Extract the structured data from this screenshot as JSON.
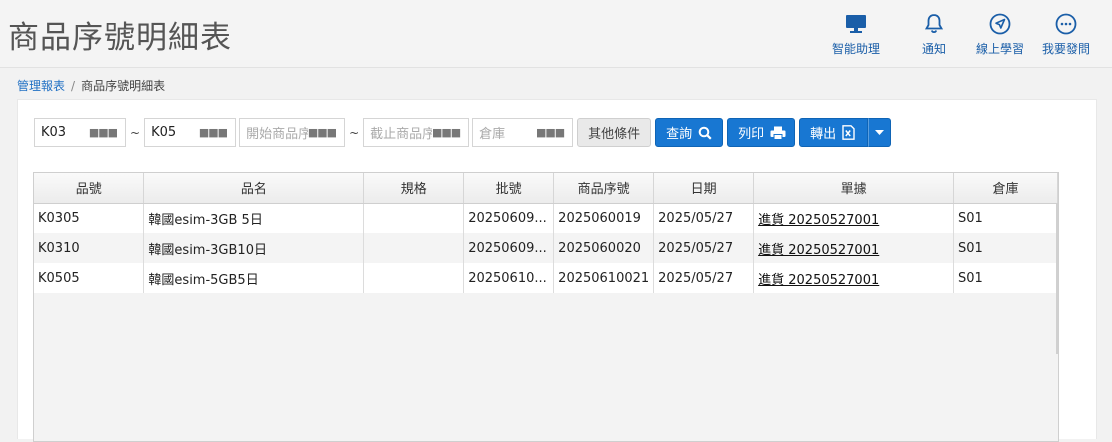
{
  "header": {
    "title": "商品序號明細表",
    "actions": [
      {
        "label": "智能助理",
        "icon": "monitor-icon"
      },
      {
        "label": "通知",
        "icon": "bell-icon"
      },
      {
        "label": "線上學習",
        "icon": "navigation-icon"
      },
      {
        "label": "我要發問",
        "icon": "chat-icon"
      }
    ]
  },
  "breadcrumb": {
    "parent": "管理報表",
    "separator": "/",
    "current": "商品序號明細表"
  },
  "filters": {
    "warehouse_from": "K03",
    "tilde": "~",
    "warehouse_to": "K05",
    "serial_from_placeholder": "開始商品序號",
    "serial_to_placeholder": "截止商品序號",
    "store_placeholder": "倉庫",
    "more_label": "其他條件",
    "query_label": "查詢",
    "print_label": "列印",
    "export_label": "轉出"
  },
  "table": {
    "columns": [
      "品號",
      "品名",
      "規格",
      "批號",
      "商品序號",
      "日期",
      "單據",
      "倉庫"
    ],
    "rows": [
      [
        "K0305",
        "韓國esim-3GB 5日",
        "",
        "20250609...",
        "2025060019",
        "2025/05/27",
        "進貨 20250527001",
        "S01"
      ],
      [
        "K0310",
        "韓國esim-3GB10日",
        "",
        "20250609...",
        "2025060020",
        "2025/05/27",
        "進貨 20250527001",
        "S01"
      ],
      [
        "K0505",
        "韓國esim-5GB5日",
        "",
        "20250610...",
        "20250610021",
        "2025/05/27",
        "進貨 20250527001",
        "S01"
      ]
    ]
  },
  "colors": {
    "accent": "#1877d2",
    "header_icon": "#1a5ea8"
  }
}
